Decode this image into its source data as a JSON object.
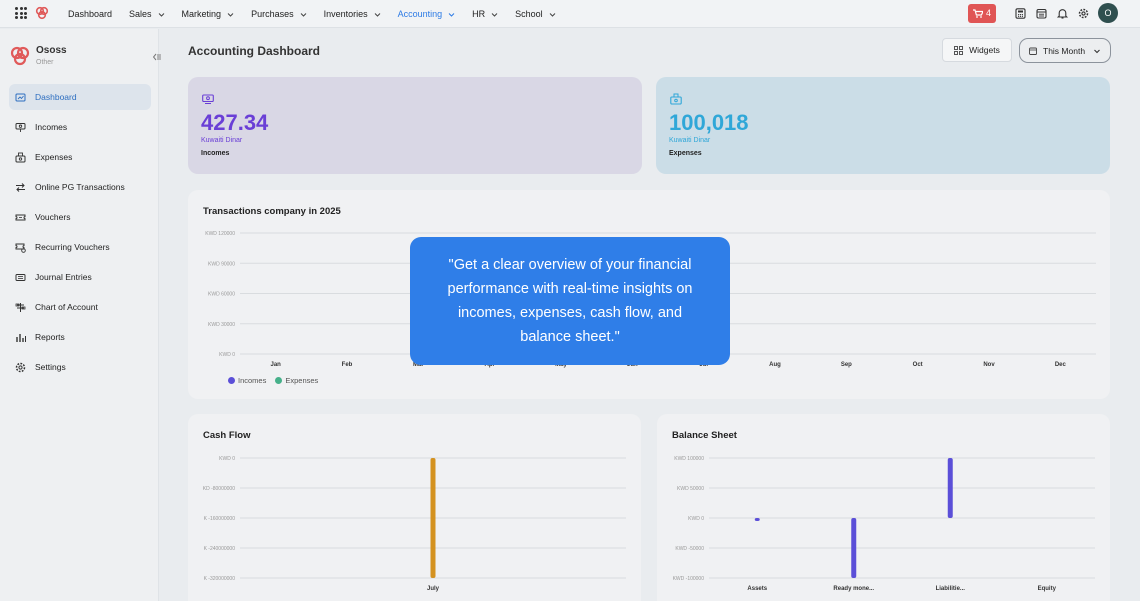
{
  "topbar": {
    "nav": [
      {
        "label": "Dashboard",
        "dropdown": false,
        "active": false
      },
      {
        "label": "Sales",
        "dropdown": true,
        "active": false
      },
      {
        "label": "Marketing",
        "dropdown": true,
        "active": false
      },
      {
        "label": "Purchases",
        "dropdown": true,
        "active": false
      },
      {
        "label": "Inventories",
        "dropdown": true,
        "active": false
      },
      {
        "label": "Accounting",
        "dropdown": true,
        "active": true
      },
      {
        "label": "HR",
        "dropdown": true,
        "active": false
      },
      {
        "label": "School",
        "dropdown": true,
        "active": false
      }
    ],
    "cart_count": "4",
    "avatar_initial": "O"
  },
  "sidebar": {
    "brand_name": "Ososs",
    "brand_sub": "Other",
    "items": [
      {
        "label": "Dashboard",
        "icon": "dashboard-icon",
        "active": true
      },
      {
        "label": "Incomes",
        "icon": "incomes-icon",
        "active": false
      },
      {
        "label": "Expenses",
        "icon": "expenses-icon",
        "active": false
      },
      {
        "label": "Online PG Transactions",
        "icon": "transfer-icon",
        "active": false
      },
      {
        "label": "Vouchers",
        "icon": "voucher-icon",
        "active": false
      },
      {
        "label": "Recurring Vouchers",
        "icon": "recurring-voucher-icon",
        "active": false
      },
      {
        "label": "Journal Entries",
        "icon": "journal-icon",
        "active": false
      },
      {
        "label": "Chart of Account",
        "icon": "chart-of-account-icon",
        "active": false
      },
      {
        "label": "Reports",
        "icon": "reports-icon",
        "active": false
      },
      {
        "label": "Settings",
        "icon": "settings-icon",
        "active": false
      }
    ]
  },
  "header": {
    "title": "Accounting Dashboard",
    "widgets_label": "Widgets",
    "period_label": "This Month"
  },
  "stats": {
    "income": {
      "value": "427.34",
      "currency": "Kuwaiti Dinar",
      "label": "Incomes",
      "color": "#6a3fd6"
    },
    "expense": {
      "value": "100,018",
      "currency": "Kuwaiti Dinar",
      "label": "Expenses",
      "color": "#2fa7d8"
    }
  },
  "tooltip": {
    "text": "\"Get a clear overview of your financial performance with real-time insights on incomes, expenses, cash flow, and balance sheet.\""
  },
  "colors": {
    "incomes": "#5b4fd8",
    "expenses": "#46b08a",
    "cashflow": "#d49220",
    "balance": "#5b4fd8"
  },
  "chart_data": [
    {
      "type": "bar",
      "title": "Transactions company in 2025",
      "categories": [
        "Jan",
        "Feb",
        "Mar",
        "Apr",
        "May",
        "Jun",
        "Jul",
        "Aug",
        "Sep",
        "Oct",
        "Nov",
        "Dec"
      ],
      "y_ticks": [
        "KWD 120000",
        "KWD 90000",
        "KWD 60000",
        "KWD 30000",
        "KWD 0"
      ],
      "ylim": [
        0,
        120000
      ],
      "series": [
        {
          "name": "Incomes",
          "values": [
            0,
            0,
            0,
            0,
            0,
            0,
            0,
            0,
            0,
            0,
            0,
            0
          ]
        },
        {
          "name": "Expenses",
          "values": [
            0,
            0,
            0,
            0,
            0,
            0,
            0,
            0,
            0,
            0,
            0,
            0
          ]
        }
      ],
      "legend": "bottom-left"
    },
    {
      "type": "bar",
      "title": "Cash Flow",
      "categories": [
        "July"
      ],
      "y_ticks": [
        "KWD 0",
        "KD -80000000",
        "K -160000000",
        "K -240000000",
        "K -320000000"
      ],
      "ylim": [
        -320000000,
        0
      ],
      "values": [
        -320000000
      ]
    },
    {
      "type": "bar",
      "title": "Balance Sheet",
      "categories": [
        "Assets",
        "Ready mone...",
        "Liabilitie...",
        "Equity"
      ],
      "y_ticks": [
        "KWD 100000",
        "KWD 50000",
        "KWD 0",
        "KWD -50000",
        "KWD -100000"
      ],
      "ylim": [
        -100000,
        100000
      ],
      "values": [
        -5000,
        -100000,
        100000,
        0
      ]
    }
  ]
}
